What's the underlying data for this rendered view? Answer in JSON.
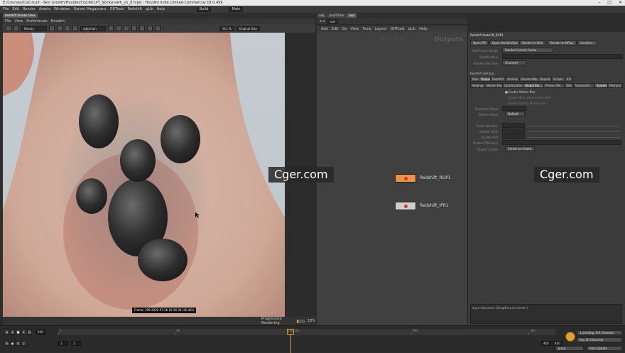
{
  "window": {
    "title": "E:/Courses/CGCircuit - Skin Growth/Houdini/CGCIRCUIT_SkinGrowth_v1_8.hiplc - Houdini Indie Limited-Commercial 18.0.499",
    "desktop_label": "Build",
    "main_label": "Main"
  },
  "menubar": [
    "File",
    "Edit",
    "Render",
    "Assets",
    "Windows",
    "Qwixel Megascans",
    "ODTools",
    "Redshift",
    "qLib",
    "Help"
  ],
  "renderview": {
    "tab": "Redshift Render View",
    "menu": [
      "File",
      "View",
      "Preferences",
      "Houdini"
    ],
    "aov": "Beauty",
    "camera": "/obj/main",
    "zoom": "111 %",
    "size_mode": "Original Size",
    "frame_caption": "Frame: 190 2020-07-26 16:26:36 (26.46s)",
    "status_label": "Progressive Rendering",
    "progress_pct": 18,
    "progress_text": "18%"
  },
  "network": {
    "tabs": [
      "/obj",
      "/out/Chain",
      "/out"
    ],
    "path": "out",
    "menu": [
      "Add",
      "Edit",
      "Go",
      "View",
      "Tools",
      "Layout",
      "ODTools",
      "qLib",
      "Help"
    ],
    "watermark": "Skin Edition",
    "outputs": "Outputs",
    "nodes": [
      {
        "name": "Redshift_ROP1",
        "selected": true
      },
      {
        "name": "Redshift_IPR1",
        "selected": false
      }
    ]
  },
  "params": {
    "header": "Redshift  Redshift_ROP1",
    "buttons": [
      "Open IPR",
      "Open RenderView",
      "Render to Disk",
      "Render to MPlay",
      "Controls..."
    ],
    "valid_frame_range_label": "Valid Frame Range",
    "valid_frame_range_value": "Render Current Frame",
    "start_end_label": "Start/End/Inc",
    "render_with_take_label": "Render with Take",
    "render_with_take_value": "(Current)",
    "section": "Redshift Settings",
    "tabs1": [
      "Main",
      "Output",
      "Redshift",
      "Archive",
      "Render/Maps",
      "Objects",
      "Scripts",
      "IFR"
    ],
    "tabs2": [
      "Settings",
      "Motion Blur",
      "Optimizations",
      "Global Illu...",
      "Photon Ma...",
      "SSS",
      "Volumetric...",
      "System",
      "Memory"
    ],
    "enable_motion_blur": "Enable Motion Blur",
    "enable_deform": "Enable Mesh Deformation Blur",
    "enable_particle": "Enable Particle Motion Blur",
    "transform_steps": "Transform Steps",
    "deform_steps": "Deform Steps",
    "deform_value": "Default",
    "frame_duration": "Frame Duration",
    "shutter_start": "Shutter Start",
    "shutter_end": "Shutter End",
    "shutter_eff": "Shutter Efficiency",
    "shutter_center": "Shutter Center",
    "shutter_center_value": "Center on Frame",
    "input_operators": "Input Operators (Drag/Drop to reorder)"
  },
  "timeline": {
    "frame": "190",
    "start": "1",
    "end": "400",
    "end2": "400",
    "ticks": [
      "1",
      "96",
      "192",
      "288",
      "384"
    ],
    "key_status": "1 pending, 0/4 channels",
    "all_channels": "Key All Channels",
    "auto_update": "Auto Update",
    "jump": "Jump"
  },
  "watermarks": [
    "Cger.com",
    "Cger.com"
  ],
  "colors": {
    "accent": "#e0a236",
    "node_selected": "#e8924a",
    "node_default": "#cfcfcf"
  }
}
